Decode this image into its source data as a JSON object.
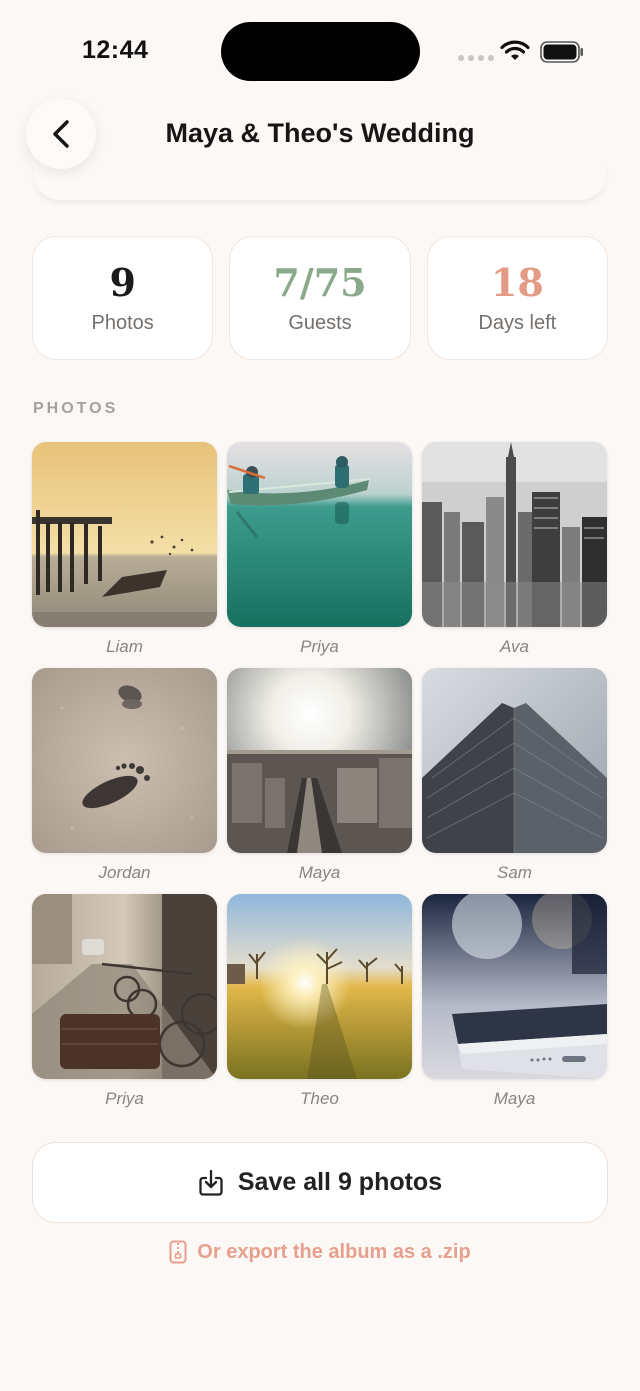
{
  "status": {
    "time": "12:44"
  },
  "header": {
    "title": "Maya & Theo's Wedding"
  },
  "stats": [
    {
      "value": "9",
      "label": "Photos",
      "color": "#1d1b1a"
    },
    {
      "value": "7/75",
      "label": "Guests",
      "color": "#8aa88a"
    },
    {
      "value": "18",
      "label": "Days left",
      "color": "#e49b86"
    }
  ],
  "photos_section": {
    "label": "PHOTOS",
    "items": [
      {
        "author": "Liam",
        "scene": "sunset pier with birds"
      },
      {
        "author": "Priya",
        "scene": "canoe on lake"
      },
      {
        "author": "Ava",
        "scene": "city skyline"
      },
      {
        "author": "Jordan",
        "scene": "footprints in sand"
      },
      {
        "author": "Maya",
        "scene": "sunlit city street"
      },
      {
        "author": "Sam",
        "scene": "skyscraper from below"
      },
      {
        "author": "Priya",
        "scene": "bicycles on street"
      },
      {
        "author": "Theo",
        "scene": "sunset over meadow"
      },
      {
        "author": "Maya",
        "scene": "phone close-up"
      }
    ]
  },
  "actions": {
    "save_all": "Save all 9 photos",
    "export_zip": "Or export the album as a .zip"
  },
  "colors": {
    "accent": "#e8a08e",
    "background": "#fcf8f5"
  }
}
